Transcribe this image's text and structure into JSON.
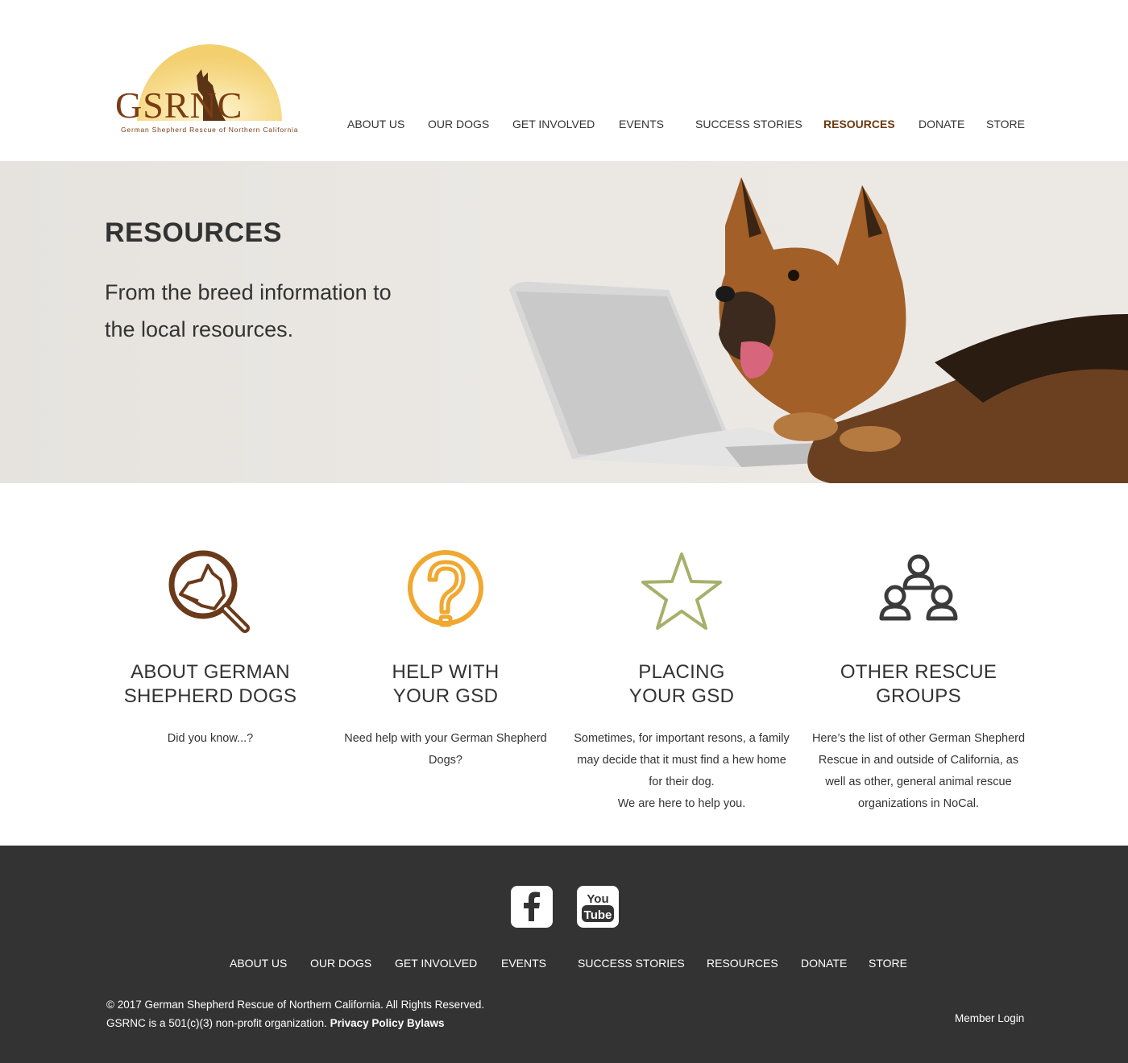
{
  "brand": {
    "logo_text": "GSRNC",
    "logo_subtitle": "German Shepherd Rescue of Northern California",
    "accent": "#6b3a10"
  },
  "nav": {
    "items": [
      "ABOUT US",
      "OUR DOGS",
      "GET INVOLVED",
      "EVENTS",
      "SUCCESS STORIES",
      "RESOURCES",
      "DONATE",
      "STORE"
    ],
    "active": "RESOURCES"
  },
  "hero": {
    "title": "RESOURCES",
    "subtitle": "From the breed information to the local resources."
  },
  "features": [
    {
      "icon": "magnifier-dog-icon",
      "color": "#6b3a1a",
      "title_line1": "ABOUT GERMAN",
      "title_line2": "SHEPHERD DOGS",
      "text": "Did you know...?"
    },
    {
      "icon": "question-mark-icon",
      "color": "#f0a830",
      "title_line1": "HELP WITH",
      "title_line2": "YOUR GSD",
      "text": "Need help with your German Shepherd Dogs?"
    },
    {
      "icon": "star-icon",
      "color": "#a6b06a",
      "title_line1": "PLACING",
      "title_line2": "YOUR GSD",
      "text": "Sometimes, for important resons, a family may decide that it must find a hew home for their dog.",
      "text2": "We are here to help you."
    },
    {
      "icon": "group-people-icon",
      "color": "#3b3b3b",
      "title_line1": "OTHER RESCUE",
      "title_line2": "GROUPS",
      "text": "Here’s the list of other German Shepherd Rescue in and outside of California, as well as other, general animal rescue organizations in NoCal."
    }
  ],
  "footer": {
    "social": [
      "facebook-icon",
      "youtube-icon"
    ],
    "youtube_you": "You",
    "youtube_tube": "Tube",
    "nav": [
      "ABOUT US",
      "OUR DOGS",
      "GET INVOLVED",
      "EVENTS",
      "SUCCESS STORIES",
      "RESOURCES",
      "DONATE",
      "STORE"
    ],
    "copyright": "©  2017 German Shepherd Rescue of Northern California. All Rights Reserved.",
    "nonprofit": "GSRNC is a 501(c)(3) non-profit organization.",
    "privacy": "Privacy Policy",
    "bylaws": "Bylaws",
    "member_login": "Member Login",
    "bg": "#333333"
  }
}
